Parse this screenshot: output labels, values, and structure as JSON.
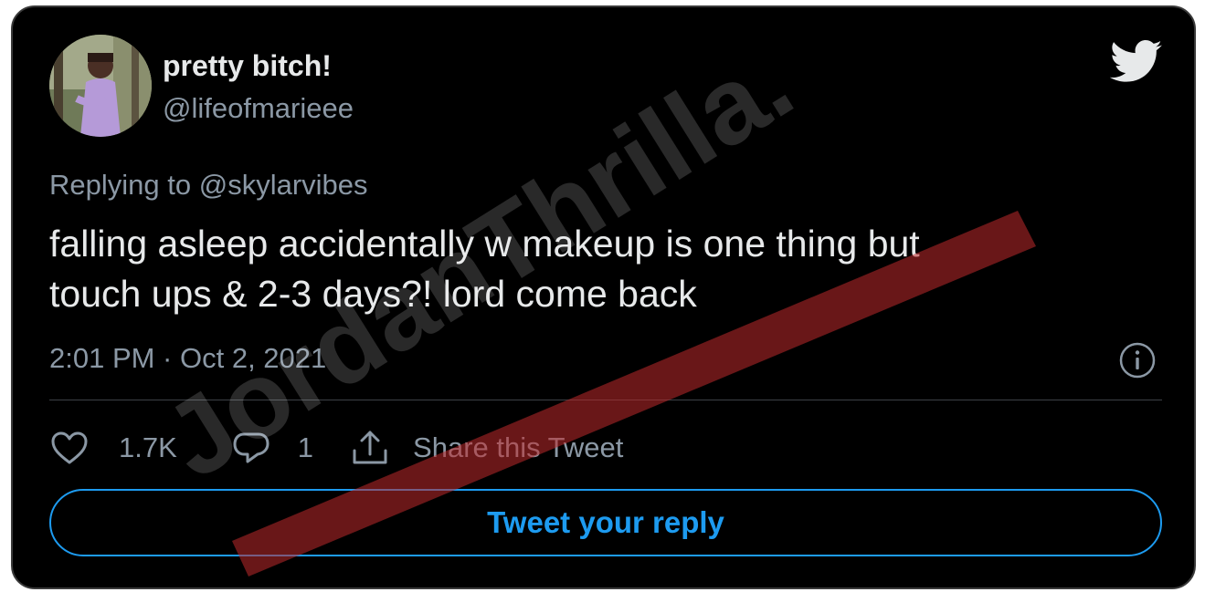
{
  "tweet": {
    "display_name": "pretty bitch!",
    "handle": "@lifeofmarieee",
    "replying_prefix": "Replying to",
    "replying_to": "@skylarvibes",
    "text_line1": "falling asleep accidentally w makeup is one thing but",
    "text_line2": "touch ups & 2-3 days?! lord come back",
    "timestamp": "2:01 PM · Oct 2, 2021"
  },
  "actions": {
    "like_count": "1.7K",
    "reply_count": "1",
    "share_label": "Share this Tweet"
  },
  "reply_button": {
    "label": "Tweet your reply"
  },
  "watermark": {
    "text": "JordanThrilla."
  },
  "icons": {
    "brand": "twitter-bird-icon",
    "info": "info-icon",
    "like": "heart-icon",
    "reply": "comment-bubble-icon",
    "share": "share-upload-icon"
  },
  "colors": {
    "background": "#000000",
    "text_primary": "#e7e9ea",
    "text_secondary": "#8b98a5",
    "accent": "#1d9bf0",
    "watermark_stripe": "#c0292b"
  }
}
